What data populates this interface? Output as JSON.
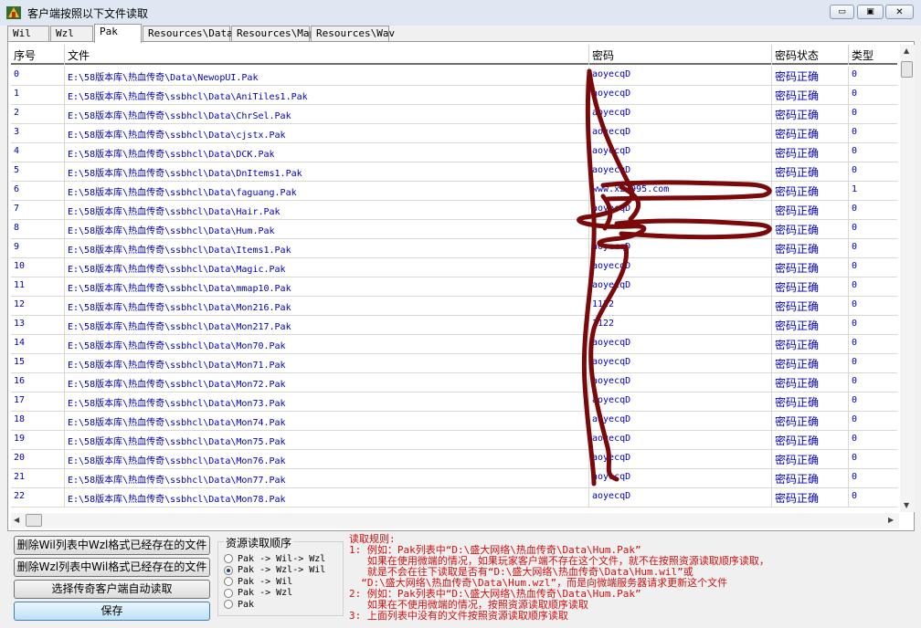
{
  "window": {
    "title": "客户端按照以下文件读取",
    "controls": {
      "minimize": "▭",
      "maximize": "▣",
      "close": "✕"
    }
  },
  "tabs": [
    "Wil",
    "Wzl",
    "Pak",
    "Resources\\Data",
    "Resources\\Map",
    "Resources\\Wav"
  ],
  "active_tab": "Pak",
  "table": {
    "columns": [
      "序号",
      "文件",
      "密码",
      "密码状态",
      "类型"
    ],
    "rows": [
      [
        "0",
        "E:\\58版本库\\热血传奇\\Data\\NewopUI.Pak",
        "aoyecqD",
        "密码正确",
        "0"
      ],
      [
        "1",
        "E:\\58版本库\\热血传奇\\ssbhcl\\Data\\AniTiles1.Pak",
        "aoyecqD",
        "密码正确",
        "0"
      ],
      [
        "2",
        "E:\\58版本库\\热血传奇\\ssbhcl\\Data\\ChrSel.Pak",
        "aoyecqD",
        "密码正确",
        "0"
      ],
      [
        "3",
        "E:\\58版本库\\热血传奇\\ssbhcl\\Data\\cjstx.Pak",
        "aoyecqD",
        "密码正确",
        "0"
      ],
      [
        "4",
        "E:\\58版本库\\热血传奇\\ssbhcl\\Data\\DCK.Pak",
        "aoyecqD",
        "密码正确",
        "0"
      ],
      [
        "5",
        "E:\\58版本库\\热血传奇\\ssbhcl\\Data\\DnItems1.Pak",
        "aoyecqD",
        "密码正确",
        "0"
      ],
      [
        "6",
        "E:\\58版本库\\热血传奇\\ssbhcl\\Data\\faguang.Pak",
        "www.xz1995.com",
        "密码正确",
        "1"
      ],
      [
        "7",
        "E:\\58版本库\\热血传奇\\ssbhcl\\Data\\Hair.Pak",
        "aoyecqD",
        "密码正确",
        "0"
      ],
      [
        "8",
        "E:\\58版本库\\热血传奇\\ssbhcl\\Data\\Hum.Pak",
        "",
        "密码正确",
        "0"
      ],
      [
        "9",
        "E:\\58版本库\\热血传奇\\ssbhcl\\Data\\Items1.Pak",
        "aoyecqD",
        "密码正确",
        "0"
      ],
      [
        "10",
        "E:\\58版本库\\热血传奇\\ssbhcl\\Data\\Magic.Pak",
        "aoyecqD",
        "密码正确",
        "0"
      ],
      [
        "11",
        "E:\\58版本库\\热血传奇\\ssbhcl\\Data\\mmap10.Pak",
        "aoyecqD",
        "密码正确",
        "0"
      ],
      [
        "12",
        "E:\\58版本库\\热血传奇\\ssbhcl\\Data\\Mon216.Pak",
        "1122",
        "密码正确",
        "0"
      ],
      [
        "13",
        "E:\\58版本库\\热血传奇\\ssbhcl\\Data\\Mon217.Pak",
        "1122",
        "密码正确",
        "0"
      ],
      [
        "14",
        "E:\\58版本库\\热血传奇\\ssbhcl\\Data\\Mon70.Pak",
        "aoyecqD",
        "密码正确",
        "0"
      ],
      [
        "15",
        "E:\\58版本库\\热血传奇\\ssbhcl\\Data\\Mon71.Pak",
        "aoyecqD",
        "密码正确",
        "0"
      ],
      [
        "16",
        "E:\\58版本库\\热血传奇\\ssbhcl\\Data\\Mon72.Pak",
        "aoyecqD",
        "密码正确",
        "0"
      ],
      [
        "17",
        "E:\\58版本库\\热血传奇\\ssbhcl\\Data\\Mon73.Pak",
        "aoyecqD",
        "密码正确",
        "0"
      ],
      [
        "18",
        "E:\\58版本库\\热血传奇\\ssbhcl\\Data\\Mon74.Pak",
        "aoyecqD",
        "密码正确",
        "0"
      ],
      [
        "19",
        "E:\\58版本库\\热血传奇\\ssbhcl\\Data\\Mon75.Pak",
        "aoyecqD",
        "密码正确",
        "0"
      ],
      [
        "20",
        "E:\\58版本库\\热血传奇\\ssbhcl\\Data\\Mon76.Pak",
        "aoyecqD",
        "密码正确",
        "0"
      ],
      [
        "21",
        "E:\\58版本库\\热血传奇\\ssbhcl\\Data\\Mon77.Pak",
        "aoyecqD",
        "密码正确",
        "0"
      ],
      [
        "22",
        "E:\\58版本库\\热血传奇\\ssbhcl\\Data\\Mon78.Pak",
        "aoyecqD",
        "密码正确",
        "0"
      ]
    ]
  },
  "buttons": {
    "delete_wil": "删除Wil列表中Wzl格式已经存在的文件",
    "delete_wzl": "删除Wzl列表中Wil格式已经存在的文件",
    "auto_read": "选择传奇客户端自动读取",
    "save": "保存"
  },
  "resource_order": {
    "title": "资源读取顺序",
    "options": [
      "Pak -> Wil-> Wzl",
      "Pak -> Wzl-> Wil",
      "Pak -> Wil",
      "Pak -> Wzl",
      "Pak"
    ],
    "selected": "Pak -> Wzl-> Wil"
  },
  "rules": {
    "lines": [
      "读取规则:",
      "1: 例如：Pak列表中“D:\\盛大网络\\热血传奇\\Data\\Hum.Pak”",
      "   如果在使用微端的情况，如果玩家客户端不存在这个文件，就不在按照资源读取顺序读取，",
      "   就是不会在往下读取是否有“D:\\盛大网络\\热血传奇\\Data\\Hum.wil”或",
      "  “D:\\盛大网络\\热血传奇\\Data\\Hum.wzl”，而是向微端服务器请求更新这个文件",
      "2: 例如：Pak列表中“D:\\盛大网络\\热血传奇\\Data\\Hum.Pak”",
      "   如果在不使用微端的情况，按照资源读取顺序读取",
      "3: 上面列表中没有的文件按照资源读取顺序读取"
    ]
  },
  "colors": {
    "link_text": "#0000c0",
    "rules_text": "#d01010",
    "scribble": "#7a0a0a"
  }
}
